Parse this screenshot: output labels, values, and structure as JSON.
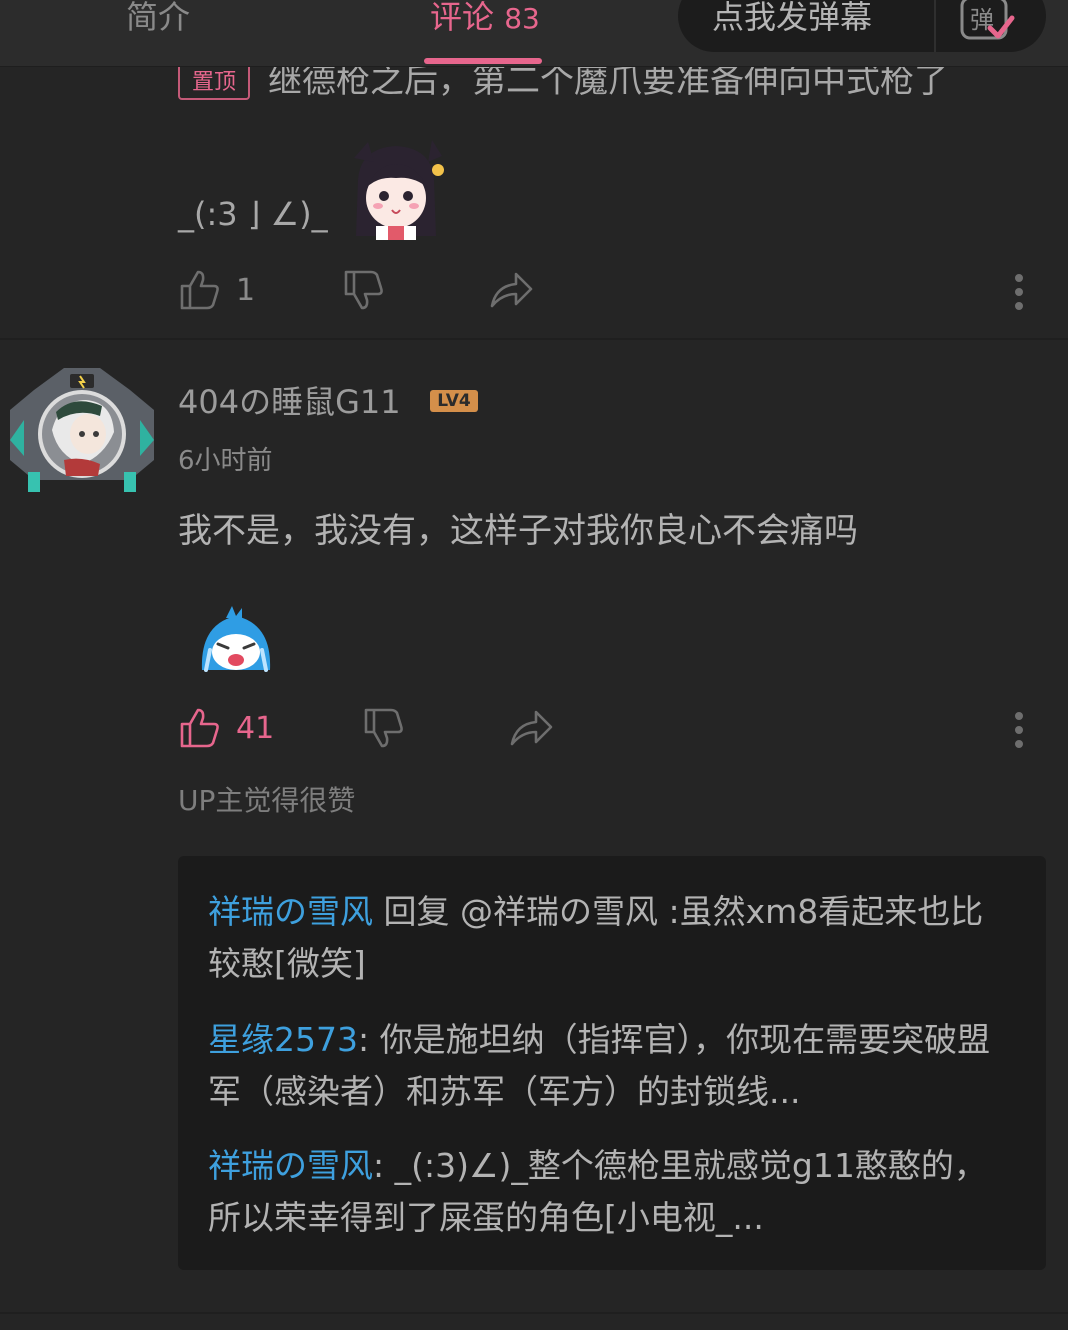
{
  "tabs": {
    "intro": "简介",
    "comments": "评论",
    "comment_count": "83"
  },
  "danmaku": {
    "label": "点我发弹幕",
    "icon_char": "弹"
  },
  "pinned": {
    "badge": "置顶",
    "text": "继德枪之后，第二个魔爪要准备伸向中式枪了",
    "kaomoji": "_(:3 ⌋ ∠)_",
    "likes": "1"
  },
  "comment2": {
    "username": "404の睡鼠G11",
    "level": "LV4",
    "time": "6小时前",
    "body": "我不是，我没有，这样子对我你良心不会痛吗",
    "likes": "41",
    "up_liked": "UP主觉得很赞",
    "replies": [
      {
        "name": "祥瑞の雪风",
        "text": " 回复 @祥瑞の雪风 :虽然xm8看起来也比较憨[微笑]"
      },
      {
        "name": "星缘2573",
        "text": ": 你是施坦纳（指挥官），你现在需要突破盟军（感染者）和苏军（军方）的封锁线..."
      },
      {
        "name": "祥瑞の雪风",
        "text": ": _(:3)∠)_整个德枪里就感觉g11憨憨的，所以荣幸得到了屎蛋的角色[小电视_..."
      }
    ]
  },
  "colors": {
    "accent": "#e7668d",
    "link": "#3ea0de",
    "background": "#252525",
    "level_badge": "#d48f4a"
  }
}
